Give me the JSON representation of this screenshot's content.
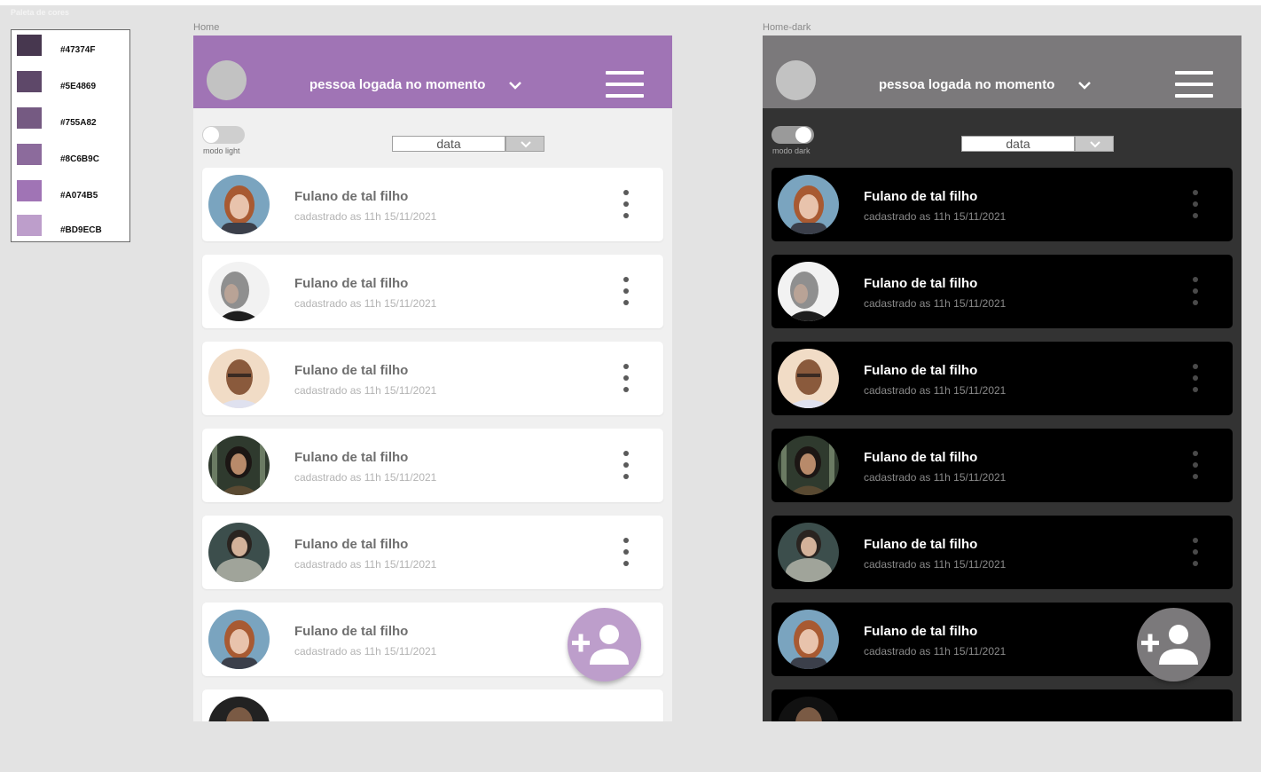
{
  "palette": {
    "title": "Paleta de cores",
    "colors": [
      {
        "label": "#47374F",
        "hex": "#47374F"
      },
      {
        "label": "#5E4869",
        "hex": "#5E4869"
      },
      {
        "label": "#755A82",
        "hex": "#755A82"
      },
      {
        "label": "#8C6B9C",
        "hex": "#8C6B9C"
      },
      {
        "label": "#A074B5",
        "hex": "#A074B5"
      },
      {
        "label": "#BD9ECB",
        "hex": "#BD9ECB"
      }
    ]
  },
  "light": {
    "frame_label": "Home",
    "header_title": "pessoa logada no momento",
    "toggle_label": "modo light",
    "toggle_on": false,
    "sort_value": "data",
    "accent": "#A074B5",
    "fab_color": "#BD9ECB",
    "fab_icon": "add-person-icon"
  },
  "dark": {
    "frame_label": "Home-dark",
    "header_title": "pessoa logada no momento",
    "toggle_label": "modo dark",
    "toggle_on": true,
    "sort_value": "data",
    "accent": "#7B797B",
    "fab_color": "#7B797B",
    "fab_icon": "add-person-icon"
  },
  "users": [
    {
      "name": "Fulano de tal filho",
      "registered": "cadastrado as 11h 15/11/2021"
    },
    {
      "name": "Fulano de tal filho",
      "registered": "cadastrado as 11h 15/11/2021"
    },
    {
      "name": "Fulano de tal filho",
      "registered": "cadastrado as 11h 15/11/2021"
    },
    {
      "name": "Fulano de tal filho",
      "registered": "cadastrado as 11h 15/11/2021"
    },
    {
      "name": "Fulano de tal filho",
      "registered": "cadastrado as 11h 15/11/2021"
    },
    {
      "name": "Fulano de tal filho",
      "registered": "cadastrado as 11h 15/11/2021"
    }
  ]
}
